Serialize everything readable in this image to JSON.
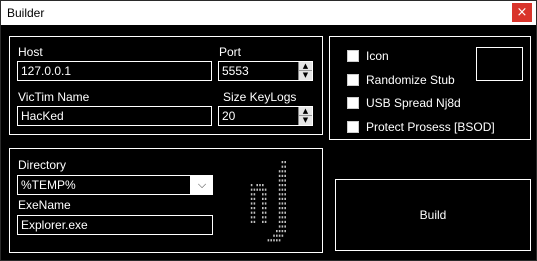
{
  "window": {
    "title": "Builder",
    "close_glyph": "×"
  },
  "connection": {
    "host_label": "Host",
    "host_value": "127.0.0.1",
    "port_label": "Port",
    "port_value": "5553",
    "victim_label": "VicTim Name",
    "victim_value": "HacKed",
    "keylogs_label": "Size KeyLogs",
    "keylogs_value": "20"
  },
  "install": {
    "directory_label": "Directory",
    "directory_value": "%TEMP%",
    "exename_label": "ExeName",
    "exename_value": "Explorer.exe"
  },
  "options": [
    {
      "label": "Icon",
      "checked": false
    },
    {
      "label": "Randomize Stub",
      "checked": false
    },
    {
      "label": "USB Spread Nj8d",
      "checked": false
    },
    {
      "label": "Protect Prosess [BSOD]",
      "checked": false
    }
  ],
  "build_label": "Build",
  "icons": {
    "spin_up": "▲",
    "spin_down": "▼",
    "dropdown": "⌵"
  },
  "colors": {
    "background": "#000000",
    "foreground": "#ffffff",
    "close_red": "#d9342b"
  }
}
